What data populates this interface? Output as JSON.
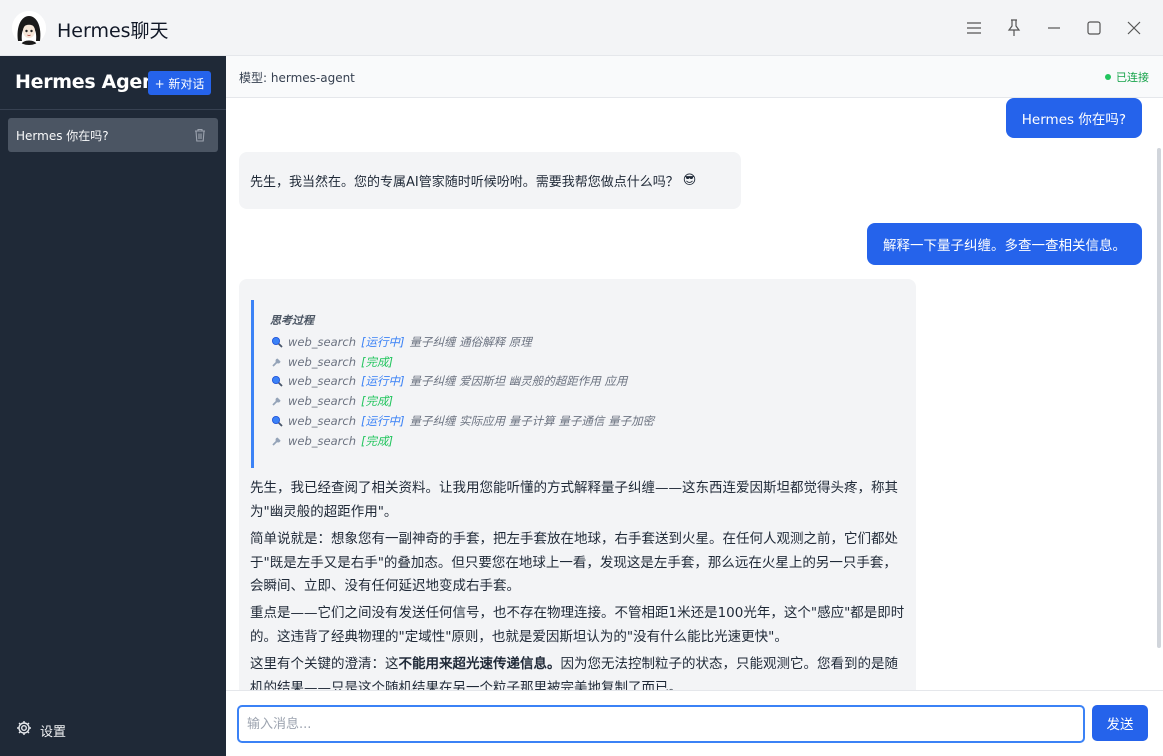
{
  "window": {
    "title": "Hermes聊天",
    "avatar_icon": "anime-girl-avatar-icon",
    "controls": [
      "menu-icon",
      "pin-icon",
      "minimize-icon",
      "maximize-icon",
      "close-icon"
    ]
  },
  "sidebar": {
    "brand": "Hermes Agent",
    "new_chat_label": "+ 新对话",
    "conversations": [
      {
        "label": "Hermes 你在吗?",
        "active": true
      }
    ],
    "settings_label": "设置"
  },
  "header": {
    "model_label": "模型: hermes-agent",
    "status_label": "已连接",
    "status_color": "#22c55e"
  },
  "messages": [
    {
      "role": "user",
      "text": "Hermes 你在吗?"
    },
    {
      "role": "assistant",
      "text": "先生，我当然在。您的专属AI管家随时听候吩咐。需要我帮您做点什么吗？",
      "emoji": "😎"
    },
    {
      "role": "user",
      "text": "解释一下量子纠缠。多查一查相关信息。"
    },
    {
      "role": "assistant",
      "thinking": {
        "title": "思考过程",
        "steps": [
          {
            "icon": "search-icon",
            "tool": "web_search",
            "status": "[运行中]",
            "query": "量子纠缠 通俗解释 原理"
          },
          {
            "icon": "wrench-icon",
            "tool": "web_search",
            "status": "[完成]",
            "query": ""
          },
          {
            "icon": "search-icon",
            "tool": "web_search",
            "status": "[运行中]",
            "query": "量子纠缠 爱因斯坦 幽灵般的超距作用 应用"
          },
          {
            "icon": "wrench-icon",
            "tool": "web_search",
            "status": "[完成]",
            "query": ""
          },
          {
            "icon": "search-icon",
            "tool": "web_search",
            "status": "[运行中]",
            "query": "量子纠缠 实际应用 量子计算 量子通信 量子加密"
          },
          {
            "icon": "wrench-icon",
            "tool": "web_search",
            "status": "[完成]",
            "query": ""
          }
        ]
      },
      "paragraphs": {
        "p1": "先生，我已经查阅了相关资料。让我用您能听懂的方式解释量子纠缠——这东西连爱因斯坦都觉得头疼，称其为\"幽灵般的超距作用\"。",
        "p2": "简单说就是：想象您有一副神奇的手套，把左手套放在地球，右手套送到火星。在任何人观测之前，它们都处于\"既是左手又是右手\"的叠加态。但只要您在地球上一看，发现这是左手套，那么远在火星上的另一只手套，会瞬间、立即、没有任何延迟地变成右手套。",
        "p3": "重点是——它们之间没有发送任何信号，也不存在物理连接。不管相距1米还是100光年，这个\"感应\"都是即时的。这违背了经典物理的\"定域性\"原则，也就是爱因斯坦认为的\"没有什么能比光速更快\"。",
        "p4_prefix": "这里有个关键的澄清：这",
        "p4_bold": "不能用来超光速传递信息。",
        "p4_suffix": "因为您无法控制粒子的状态，只能观测它。您看到的是随机的结果——只是这个随机结果在另一个粒子那里被完美地复制了而已。"
      }
    }
  ],
  "input": {
    "placeholder": "输入消息...",
    "value": "",
    "send_label": "发送"
  },
  "colors": {
    "accent": "#2563eb",
    "sidebar_bg": "#1f2937",
    "thinking_border": "#3b82f6",
    "running": "#3b82f6",
    "done": "#22c55e"
  }
}
